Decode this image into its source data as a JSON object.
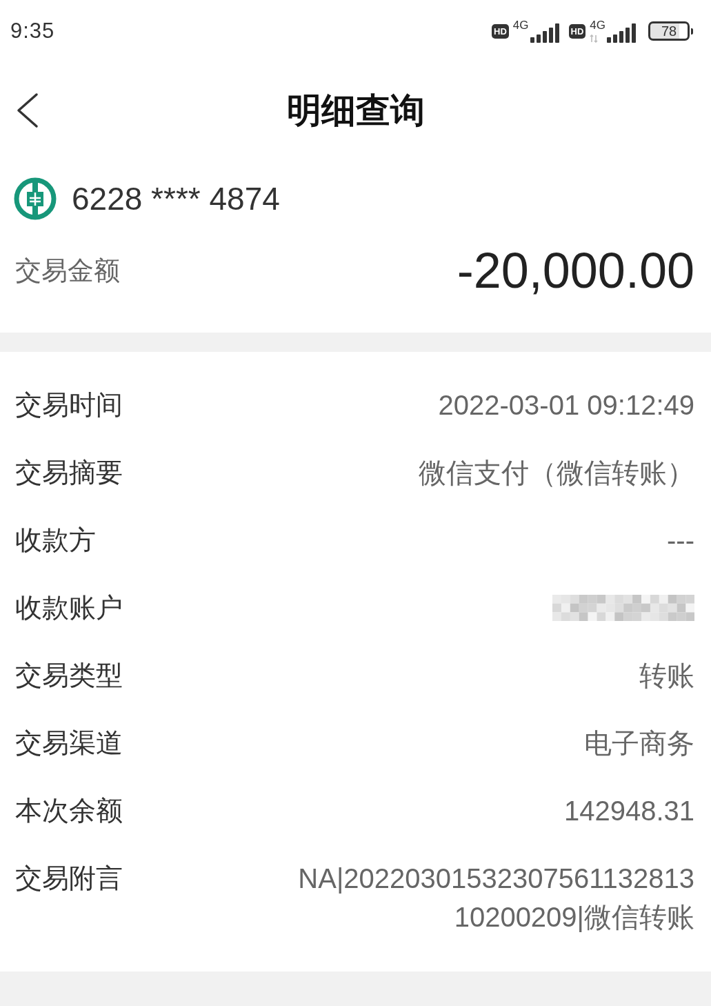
{
  "status_bar": {
    "time": "9:35",
    "sims": [
      {
        "badge": "HD",
        "network": "4G",
        "activity": false
      },
      {
        "badge": "HD",
        "network": "4G",
        "activity": true
      }
    ],
    "battery": "78"
  },
  "header": {
    "title": "明细查询"
  },
  "account": {
    "card_number": "6228 **** 4874",
    "amount_label": "交易金额",
    "amount": "-20,000.00"
  },
  "details": [
    {
      "kind": "text",
      "label": "交易时间",
      "value": "2022-03-01 09:12:49"
    },
    {
      "kind": "text",
      "label": "交易摘要",
      "value": "微信支付（微信转账）"
    },
    {
      "kind": "text",
      "label": "收款方",
      "value": "---"
    },
    {
      "kind": "redacted",
      "label": "收款账户"
    },
    {
      "kind": "text",
      "label": "交易类型",
      "value": "转账"
    },
    {
      "kind": "text",
      "label": "交易渠道",
      "value": "电子商务"
    },
    {
      "kind": "text",
      "label": "本次余额",
      "value": "142948.31"
    },
    {
      "kind": "text",
      "label": "交易附言",
      "value": "NA|20220301532307561132813\n10200209|微信转账"
    }
  ]
}
